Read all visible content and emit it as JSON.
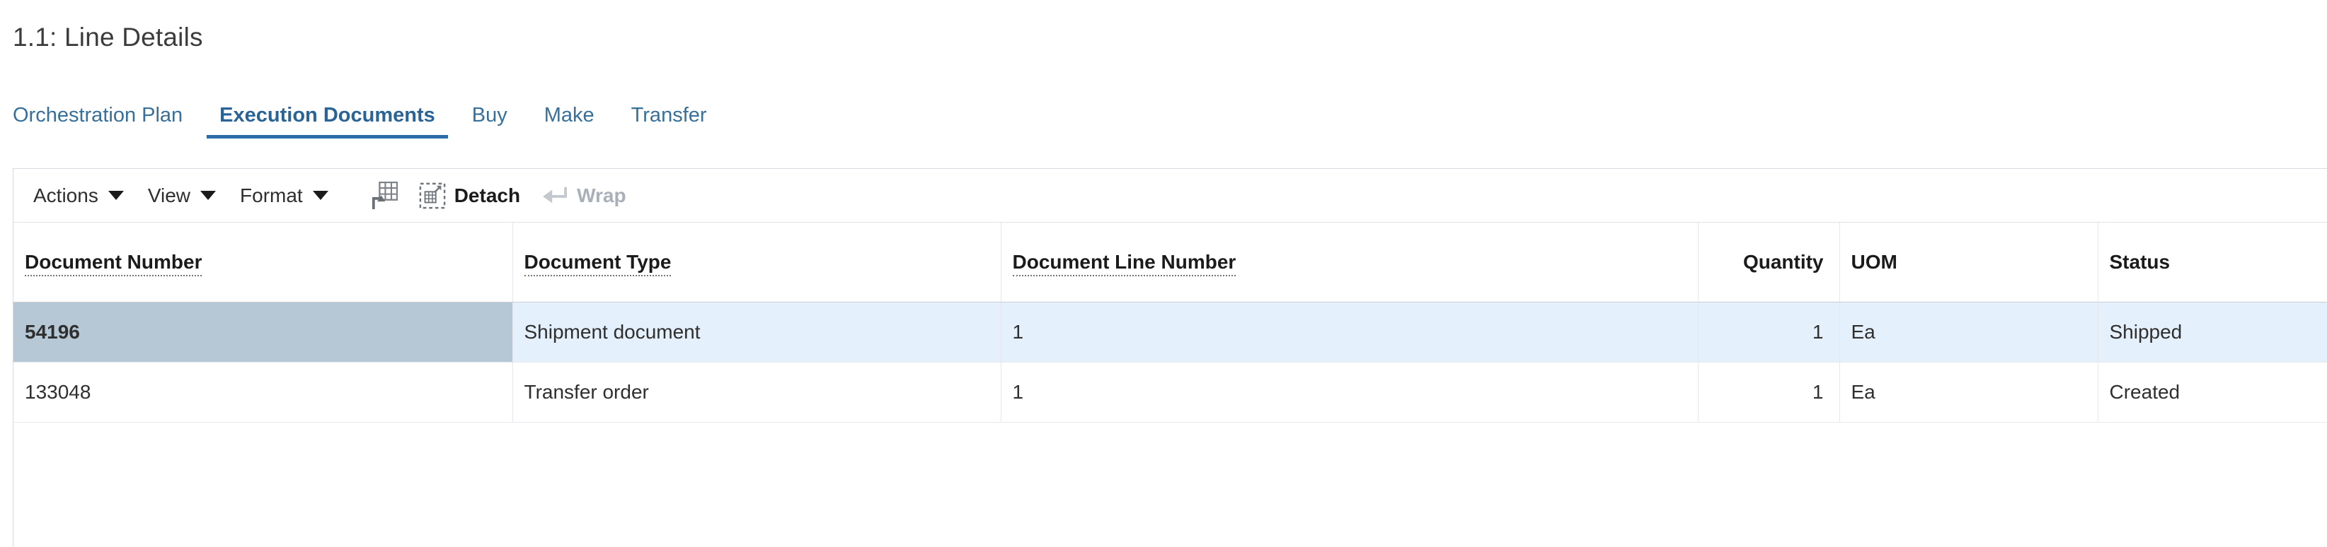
{
  "page": {
    "title": "1.1: Line Details"
  },
  "tabs": [
    {
      "label": "Orchestration Plan",
      "active": false
    },
    {
      "label": "Execution Documents",
      "active": true
    },
    {
      "label": "Buy",
      "active": false
    },
    {
      "label": "Make",
      "active": false
    },
    {
      "label": "Transfer",
      "active": false
    }
  ],
  "toolbar": {
    "actions_label": "Actions",
    "view_label": "View",
    "format_label": "Format",
    "freeze_icon": "freeze-columns-icon",
    "detach_label": "Detach",
    "detach_icon": "detach-icon",
    "wrap_label": "Wrap",
    "wrap_icon": "wrap-text-icon",
    "wrap_disabled": true
  },
  "table": {
    "columns": [
      {
        "label": "Document Number",
        "align": "left",
        "sortable": true
      },
      {
        "label": "Document Type",
        "align": "left",
        "sortable": true
      },
      {
        "label": "Document Line Number",
        "align": "left",
        "sortable": true
      },
      {
        "label": "Quantity",
        "align": "right",
        "sortable": false
      },
      {
        "label": "UOM",
        "align": "left",
        "sortable": false
      },
      {
        "label": "Status",
        "align": "left",
        "sortable": false
      }
    ],
    "rows": [
      {
        "document_number": "54196",
        "document_type": "Shipment document",
        "document_line_number": "1",
        "quantity": "1",
        "uom": "Ea",
        "status": "Shipped",
        "selected": true,
        "focused_cell": "document_number",
        "link": false
      },
      {
        "document_number": "133048",
        "document_type": "Transfer order",
        "document_line_number": "1",
        "quantity": "1",
        "uom": "Ea",
        "status": "Created",
        "selected": false,
        "focused_cell": null,
        "link": true
      }
    ]
  },
  "colors": {
    "tab_active_underline": "#2c6ca8",
    "tab_link": "#36709b",
    "row_selected_bg": "#e4f0fb",
    "cell_focus_bg": "#b6c8d6",
    "link_text": "#4a90c4"
  }
}
